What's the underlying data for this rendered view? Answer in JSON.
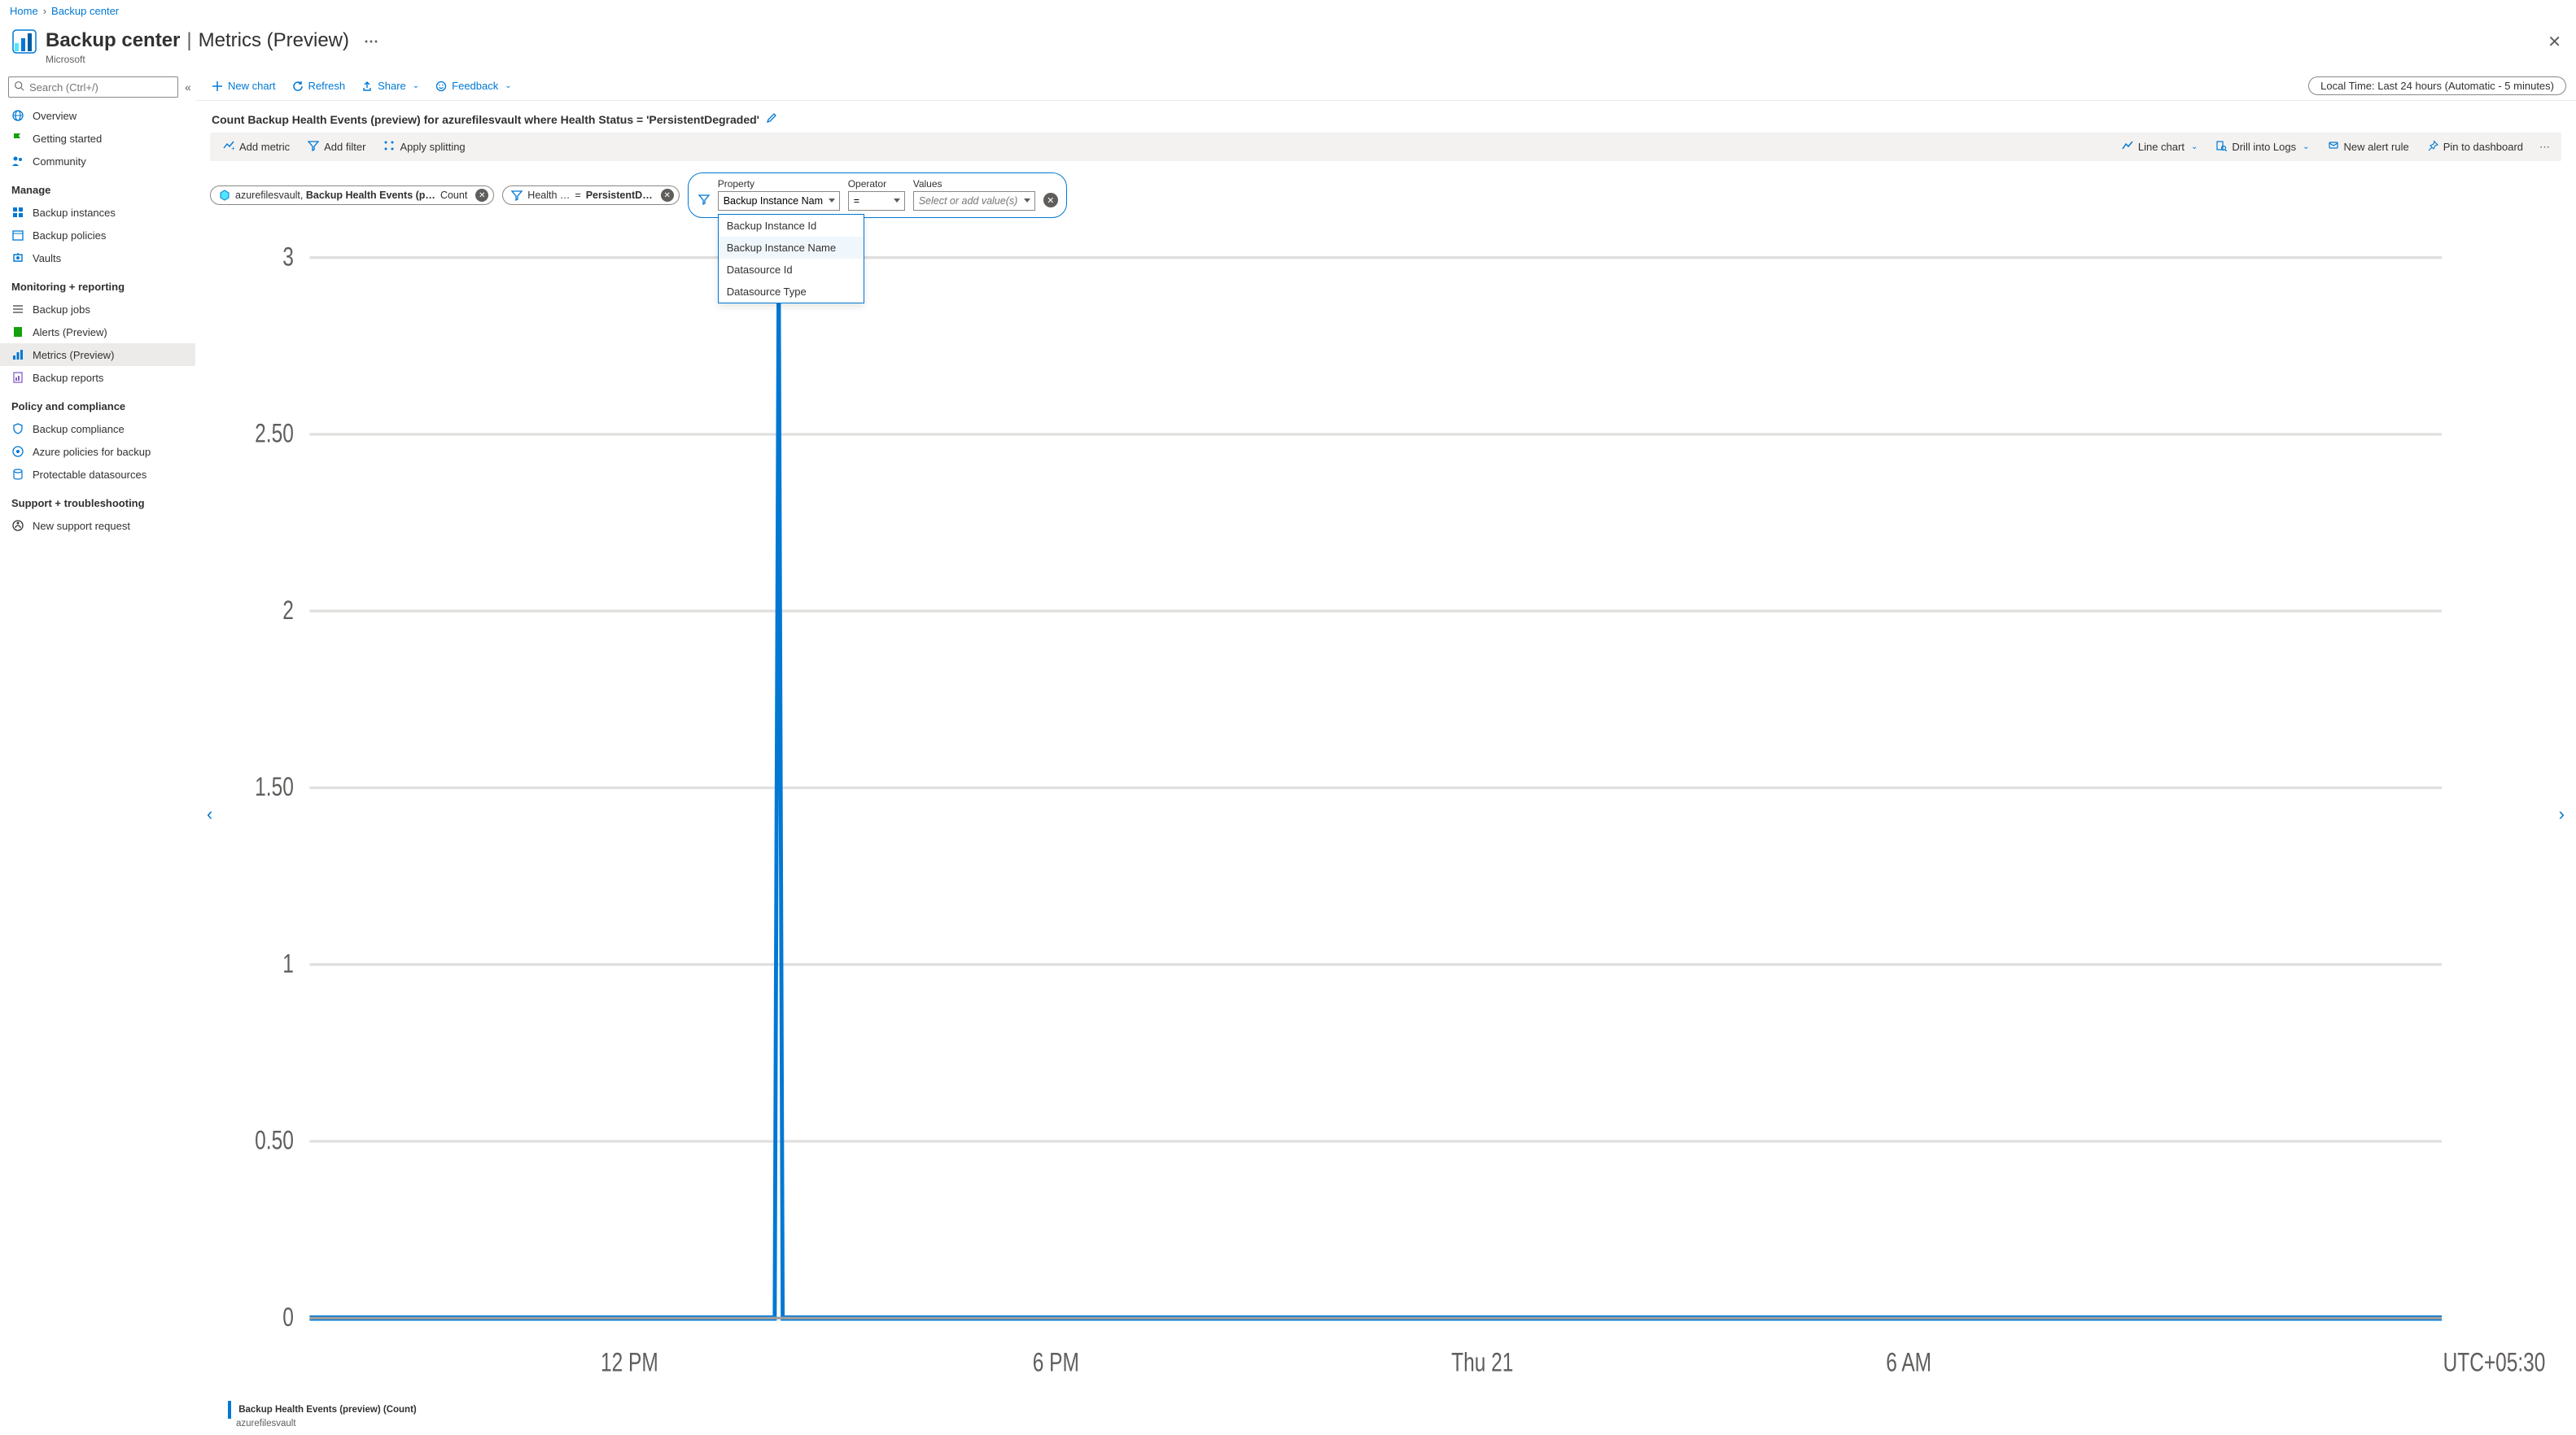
{
  "breadcrumb": {
    "home": "Home",
    "current": "Backup center"
  },
  "header": {
    "title": "Backup center",
    "subtitle_page": "Metrics (Preview)",
    "org": "Microsoft"
  },
  "sidebar": {
    "search_placeholder": "Search (Ctrl+/)",
    "top": [
      {
        "label": "Overview",
        "icon": "globe",
        "color": "#0078d4"
      },
      {
        "label": "Getting started",
        "icon": "flag",
        "color": "#13a10e"
      },
      {
        "label": "Community",
        "icon": "people",
        "color": "#0078d4"
      }
    ],
    "sections": [
      {
        "title": "Manage",
        "items": [
          {
            "label": "Backup instances",
            "icon": "grid",
            "color": "#0078d4"
          },
          {
            "label": "Backup policies",
            "icon": "calendar",
            "color": "#0078d4"
          },
          {
            "label": "Vaults",
            "icon": "vault",
            "color": "#0078d4"
          }
        ]
      },
      {
        "title": "Monitoring + reporting",
        "items": [
          {
            "label": "Backup jobs",
            "icon": "list",
            "color": "#605e5c"
          },
          {
            "label": "Alerts (Preview)",
            "icon": "book",
            "color": "#13a10e"
          },
          {
            "label": "Metrics (Preview)",
            "icon": "metrics",
            "color": "#0078d4",
            "selected": true
          },
          {
            "label": "Backup reports",
            "icon": "report",
            "color": "#8661c5"
          }
        ]
      },
      {
        "title": "Policy and compliance",
        "items": [
          {
            "label": "Backup compliance",
            "icon": "shield",
            "color": "#0078d4"
          },
          {
            "label": "Azure policies for backup",
            "icon": "policy",
            "color": "#0078d4"
          },
          {
            "label": "Protectable datasources",
            "icon": "datasource",
            "color": "#0078d4"
          }
        ]
      },
      {
        "title": "Support + troubleshooting",
        "items": [
          {
            "label": "New support request",
            "icon": "support",
            "color": "#323130"
          }
        ]
      }
    ]
  },
  "toolbar": {
    "new_chart": "New chart",
    "refresh": "Refresh",
    "share": "Share",
    "feedback": "Feedback",
    "time_range": "Local Time: Last 24 hours (Automatic - 5 minutes)"
  },
  "chart_header": {
    "title": "Count Backup Health Events (preview) for azurefilesvault where Health Status = 'PersistentDegraded'"
  },
  "metric_bar": {
    "add_metric": "Add metric",
    "add_filter": "Add filter",
    "apply_splitting": "Apply splitting",
    "line_chart": "Line chart",
    "drill_logs": "Drill into Logs",
    "new_alert": "New alert rule",
    "pin": "Pin to dashboard"
  },
  "pills": {
    "metric_resource": "azurefilesvault",
    "metric_name": "Backup Health Events (p…",
    "metric_agg": "Count",
    "filter_dim": "Health …",
    "filter_op": "=",
    "filter_val": "PersistentD…"
  },
  "filter_panel": {
    "property_label": "Property",
    "property_value": "Backup Instance Name",
    "operator_label": "Operator",
    "operator_value": "=",
    "values_label": "Values",
    "values_placeholder": "Select or add value(s)",
    "dropdown": [
      "Backup Instance Id",
      "Backup Instance Name",
      "Datasource Id",
      "Datasource Type"
    ],
    "dropdown_highlight": 1
  },
  "chart_data": {
    "type": "line",
    "series": [
      {
        "name": "Backup Health Events (preview) (Count)",
        "resource": "azurefilesvault",
        "x": [
          "12 PM",
          "1:30 PM",
          "6 PM",
          "Thu 21",
          "6 AM"
        ],
        "values": [
          0,
          3,
          0,
          0,
          0
        ]
      }
    ],
    "ylim": [
      0,
      3
    ],
    "yticks": [
      0,
      0.5,
      1,
      1.5,
      2,
      2.5,
      3
    ],
    "xticks": [
      "12 PM",
      "6 PM",
      "Thu 21",
      "6 AM"
    ],
    "tz": "UTC+05:30"
  },
  "legend": {
    "line1": "Backup Health Events (preview) (Count)",
    "line2": "azurefilesvault"
  }
}
